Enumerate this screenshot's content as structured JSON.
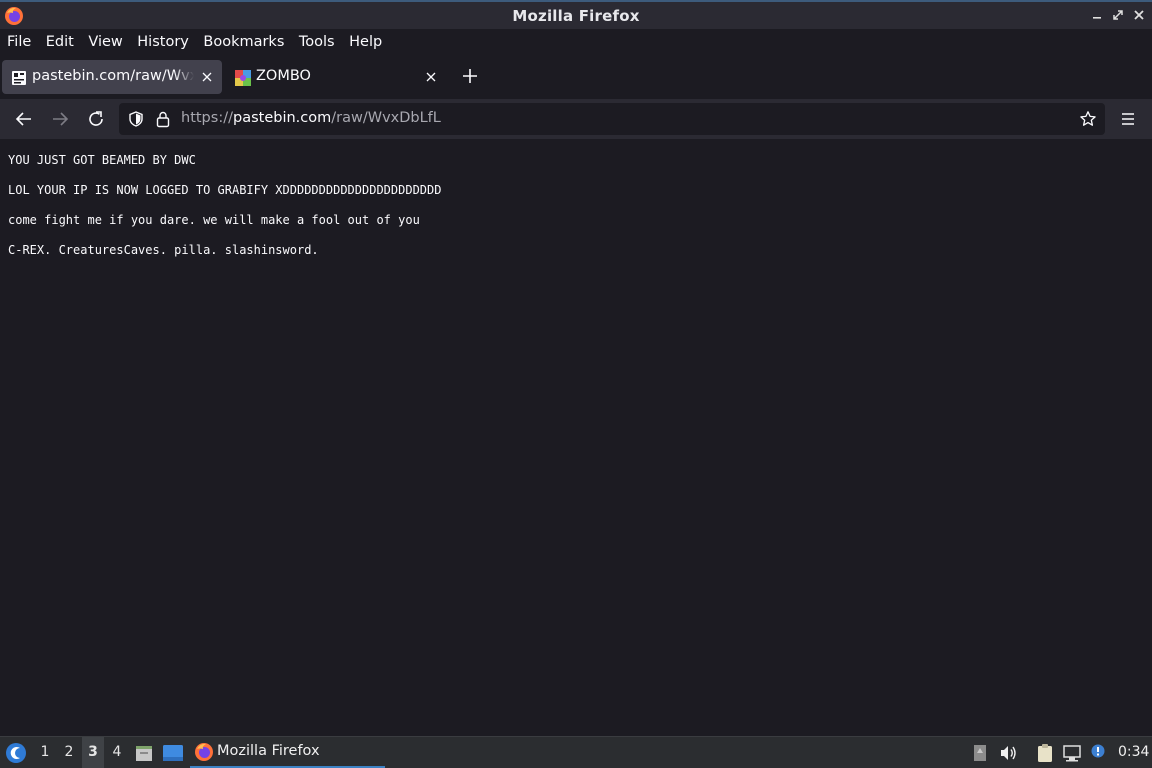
{
  "window": {
    "title": "Mozilla Firefox"
  },
  "menubar": {
    "items": [
      "File",
      "Edit",
      "View",
      "History",
      "Bookmarks",
      "Tools",
      "Help"
    ]
  },
  "tabs": [
    {
      "label": "pastebin.com/raw/WvxDbLfL",
      "active": true
    },
    {
      "label": "ZOMBO",
      "active": false
    }
  ],
  "urlbar": {
    "prefix": "https://",
    "host": "pastebin.com",
    "path": "/raw/WvxDbLfL"
  },
  "page": {
    "lines": [
      "YOU JUST GOT BEAMED BY DWC",
      "LOL YOUR IP IS NOW LOGGED TO GRABIFY XDDDDDDDDDDDDDDDDDDDDDD",
      "come fight me if you dare. we will make a fool out of you",
      "C-REX. CreaturesCaves. pilla. slashinsword."
    ]
  },
  "taskbar": {
    "workspaces": [
      "1",
      "2",
      "3",
      "4"
    ],
    "active_workspace": "3",
    "task_label": "Mozilla Firefox",
    "clock": "0:34"
  },
  "colors": {
    "accent": "#3c82c4",
    "toolbar": "#2b2a33",
    "background": "#1c1b22"
  },
  "icons": [
    "firefox-icon",
    "minimize-icon",
    "maximize-icon",
    "close-icon",
    "pastebin-favicon",
    "zombo-favicon",
    "tab-close-icon",
    "new-tab-icon",
    "back-icon",
    "forward-icon",
    "reload-icon",
    "shield-icon",
    "lock-icon",
    "bookmark-star-icon",
    "app-menu-icon",
    "start-menu-icon",
    "file-manager-icon",
    "show-desktop-icon",
    "volume-icon",
    "clipboard-icon",
    "network-icon",
    "notification-icon"
  ]
}
